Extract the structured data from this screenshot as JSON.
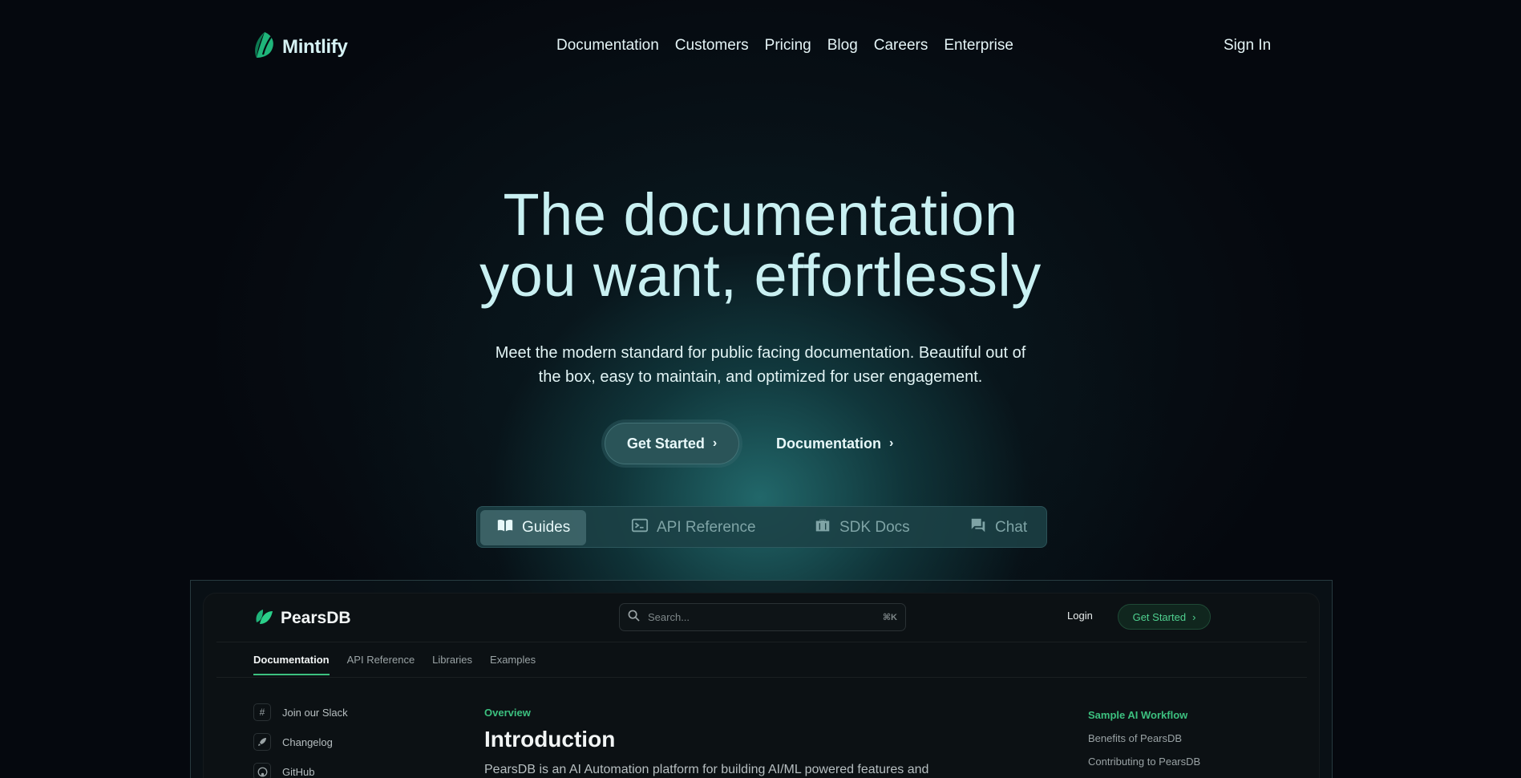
{
  "nav": {
    "brand": "Mintlify",
    "links": [
      "Documentation",
      "Customers",
      "Pricing",
      "Blog",
      "Careers",
      "Enterprise"
    ],
    "sign_in": "Sign In"
  },
  "hero": {
    "title_line1": "The documentation",
    "title_line2": "you want, effortlessly",
    "subtitle_line1": "Meet the modern standard for public facing documentation. Beautiful out of",
    "subtitle_line2": "the box, easy to maintain, and optimized for user engagement.",
    "primary_cta": "Get Started",
    "secondary_cta": "Documentation"
  },
  "tabs": [
    {
      "label": "Guides",
      "icon": "book-open-icon",
      "active": true
    },
    {
      "label": "API Reference",
      "icon": "terminal-icon",
      "active": false
    },
    {
      "label": "SDK Docs",
      "icon": "briefcase-icon",
      "active": false
    },
    {
      "label": "Chat",
      "icon": "chat-bubbles-icon",
      "active": false
    }
  ],
  "preview": {
    "brand": "PearsDB",
    "search_placeholder": "Search...",
    "search_shortcut": "⌘K",
    "login": "Login",
    "get_started": "Get Started",
    "tabs": [
      "Documentation",
      "API Reference",
      "Libraries",
      "Examples"
    ],
    "sidebar": [
      {
        "label": "Join our Slack",
        "icon": "slack-icon"
      },
      {
        "label": "Changelog",
        "icon": "rocket-icon"
      },
      {
        "label": "GitHub",
        "icon": "github-icon"
      }
    ],
    "section_label": "Overview",
    "heading": "Introduction",
    "body": "PearsDB is an AI Automation platform for building AI/ML powered features and",
    "toc": [
      "Sample AI Workflow",
      "Benefits of PearsDB",
      "Contributing to PearsDB"
    ]
  },
  "colors": {
    "background": "#05080e",
    "accent_teal": "#2a5458",
    "accent_green": "#3cc07f",
    "title_text": "#c9f0f2"
  }
}
